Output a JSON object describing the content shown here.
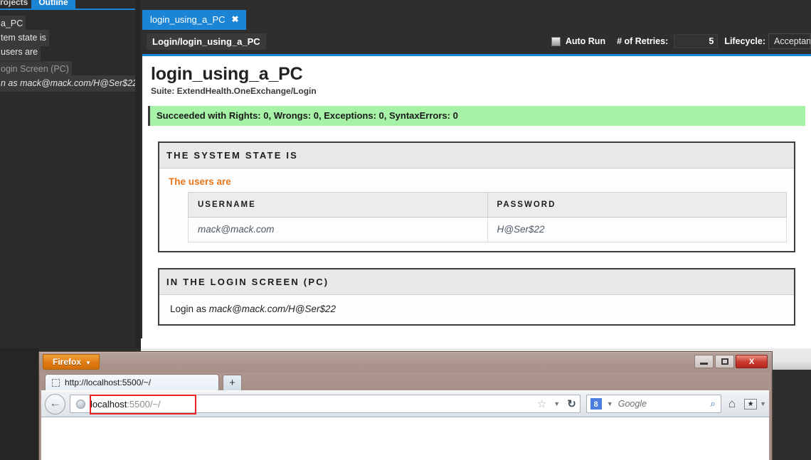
{
  "ide": {
    "sidebar": {
      "tabs": [
        {
          "label": "rojects"
        },
        {
          "label": "Outline"
        }
      ],
      "outline_items": [
        {
          "label": "a_PC"
        },
        {
          "label": "tem state is"
        },
        {
          "label": "users are"
        },
        {
          "label": "ogin Screen (PC)"
        },
        {
          "label": "n as mack@mack.com/H@Ser$22"
        }
      ]
    },
    "doc_tab": {
      "label": "login_using_a_PC",
      "close_icon": "✖"
    },
    "breadcrumb": "Login/login_using_a_PC",
    "toolbar": {
      "auto_run_label": "Auto Run",
      "retries_label": "# of Retries:",
      "retries_value": "5",
      "lifecycle_label": "Lifecycle:",
      "lifecycle_value": "Acceptance"
    }
  },
  "page": {
    "title": "login_using_a_PC",
    "suite": "Suite: ExtendHealth.OneExchange/Login",
    "status_banner": "Succeeded with Rights: 0, Wrongs: 0, Exceptions: 0, SyntaxErrors: 0",
    "panels": [
      {
        "heading": "THE SYSTEM STATE IS",
        "scenario_title": "The users are",
        "table": {
          "columns": [
            "USERNAME",
            "PASSWORD"
          ],
          "rows": [
            [
              "mack@mack.com",
              "H@Ser$22"
            ]
          ]
        }
      },
      {
        "heading": "IN THE LOGIN SCREEN (PC)",
        "line_prefix": "Login as ",
        "line_value": "mack@mack.com/H@Ser$22"
      }
    ]
  },
  "firefox": {
    "app_button": "Firefox",
    "app_button_caret": "▼",
    "window_controls": {
      "minimize": "",
      "restore": "",
      "close": "X"
    },
    "tab_title": "http://localhost:5500/~/",
    "new_tab_icon": "+",
    "back_icon": "←",
    "url_plain": "localhost",
    "url_dim": ":5500/~/",
    "star_icon": "☆",
    "caret_icon": "▼",
    "reload_icon": "↻",
    "search_engine_initial": "8",
    "search_placeholder": "Google",
    "magnifier_icon": "⌕",
    "home_icon": "⌂",
    "bookmark_icon": "★",
    "bookmark_caret": "▼"
  },
  "colors": {
    "ide_background": "#2e2e2e",
    "accent_blue": "#1c84d4",
    "success_green": "#a6f2a6",
    "scenario_orange": "#e8761b",
    "firefox_orange": "#e07b13",
    "url_highlight_red": "#ee2222"
  }
}
